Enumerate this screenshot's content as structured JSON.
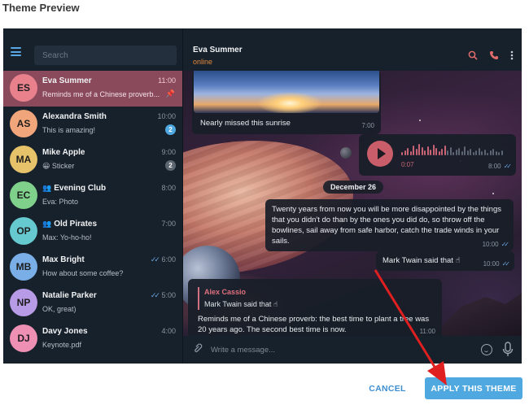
{
  "dialog": {
    "title": "Theme Preview"
  },
  "sidebar": {
    "search_placeholder": "Search",
    "chats": [
      {
        "initials": "ES",
        "name": "Eva Summer",
        "preview": "Reminds me of a Chinese proverb...",
        "time": "11:00",
        "avatar_color": "#e8818c",
        "active": true,
        "pinned": true
      },
      {
        "initials": "AS",
        "name": "Alexandra Smith",
        "preview": "This is amazing!",
        "time": "10:00",
        "avatar_color": "#f0a57a",
        "badge": "2"
      },
      {
        "initials": "MA",
        "name": "Mike Apple",
        "preview": "😀 Sticker",
        "time": "9:00",
        "avatar_color": "#e6c26a",
        "badge": "2"
      },
      {
        "initials": "EC",
        "name": "Evening Club",
        "preview": "Eva: Photo",
        "time": "8:00",
        "avatar_color": "#7fd08a",
        "group": true
      },
      {
        "initials": "OP",
        "name": "Old Pirates",
        "preview": "Max: Yo-ho-ho!",
        "time": "7:00",
        "avatar_color": "#66c9cf",
        "group": true
      },
      {
        "initials": "MB",
        "name": "Max Bright",
        "preview": "How about some coffee?",
        "time": "6:00",
        "avatar_color": "#79aee6",
        "read": true
      },
      {
        "initials": "NP",
        "name": "Natalie Parker",
        "preview": "OK, great)",
        "time": "5:00",
        "avatar_color": "#b79be6",
        "read": true
      },
      {
        "initials": "DJ",
        "name": "Davy Jones",
        "preview": "Keynote.pdf",
        "time": "4:00",
        "avatar_color": "#ee8fb4"
      }
    ]
  },
  "header": {
    "name": "Eva Summer",
    "status": "online",
    "icons": [
      "search-icon",
      "phone-icon",
      "more-icon"
    ]
  },
  "messages": {
    "photo": {
      "caption": "Nearly missed this sunrise",
      "time": "7:00"
    },
    "voice": {
      "duration": "0:07",
      "time": "8:00",
      "progress": 0.45
    },
    "date": "December 26",
    "quote": {
      "text": "Twenty years from now you will be more disappointed by the things that you didn't do than by the ones you did do, so throw off the bowlines, sail away from safe harbor, catch the trade winds in your sails.",
      "time": "10:00"
    },
    "attribution": {
      "text": "Mark Twain said that ☝",
      "time": "10:00"
    },
    "reply": {
      "author": "Alex Cassio",
      "quoted": "Mark Twain said that ☝",
      "text": "Reminds me of a Chinese proverb: the best time to plant a tree was 20 years ago. The second best time is now.",
      "time": "11:00"
    }
  },
  "composer": {
    "placeholder": "Write a message..."
  },
  "footer": {
    "cancel_label": "CANCEL",
    "apply_label": "APPLY THIS THEME"
  },
  "colors": {
    "accent": "#4fa8e0",
    "active_chat": "#8a4a5b",
    "arrow": "#e02020"
  }
}
